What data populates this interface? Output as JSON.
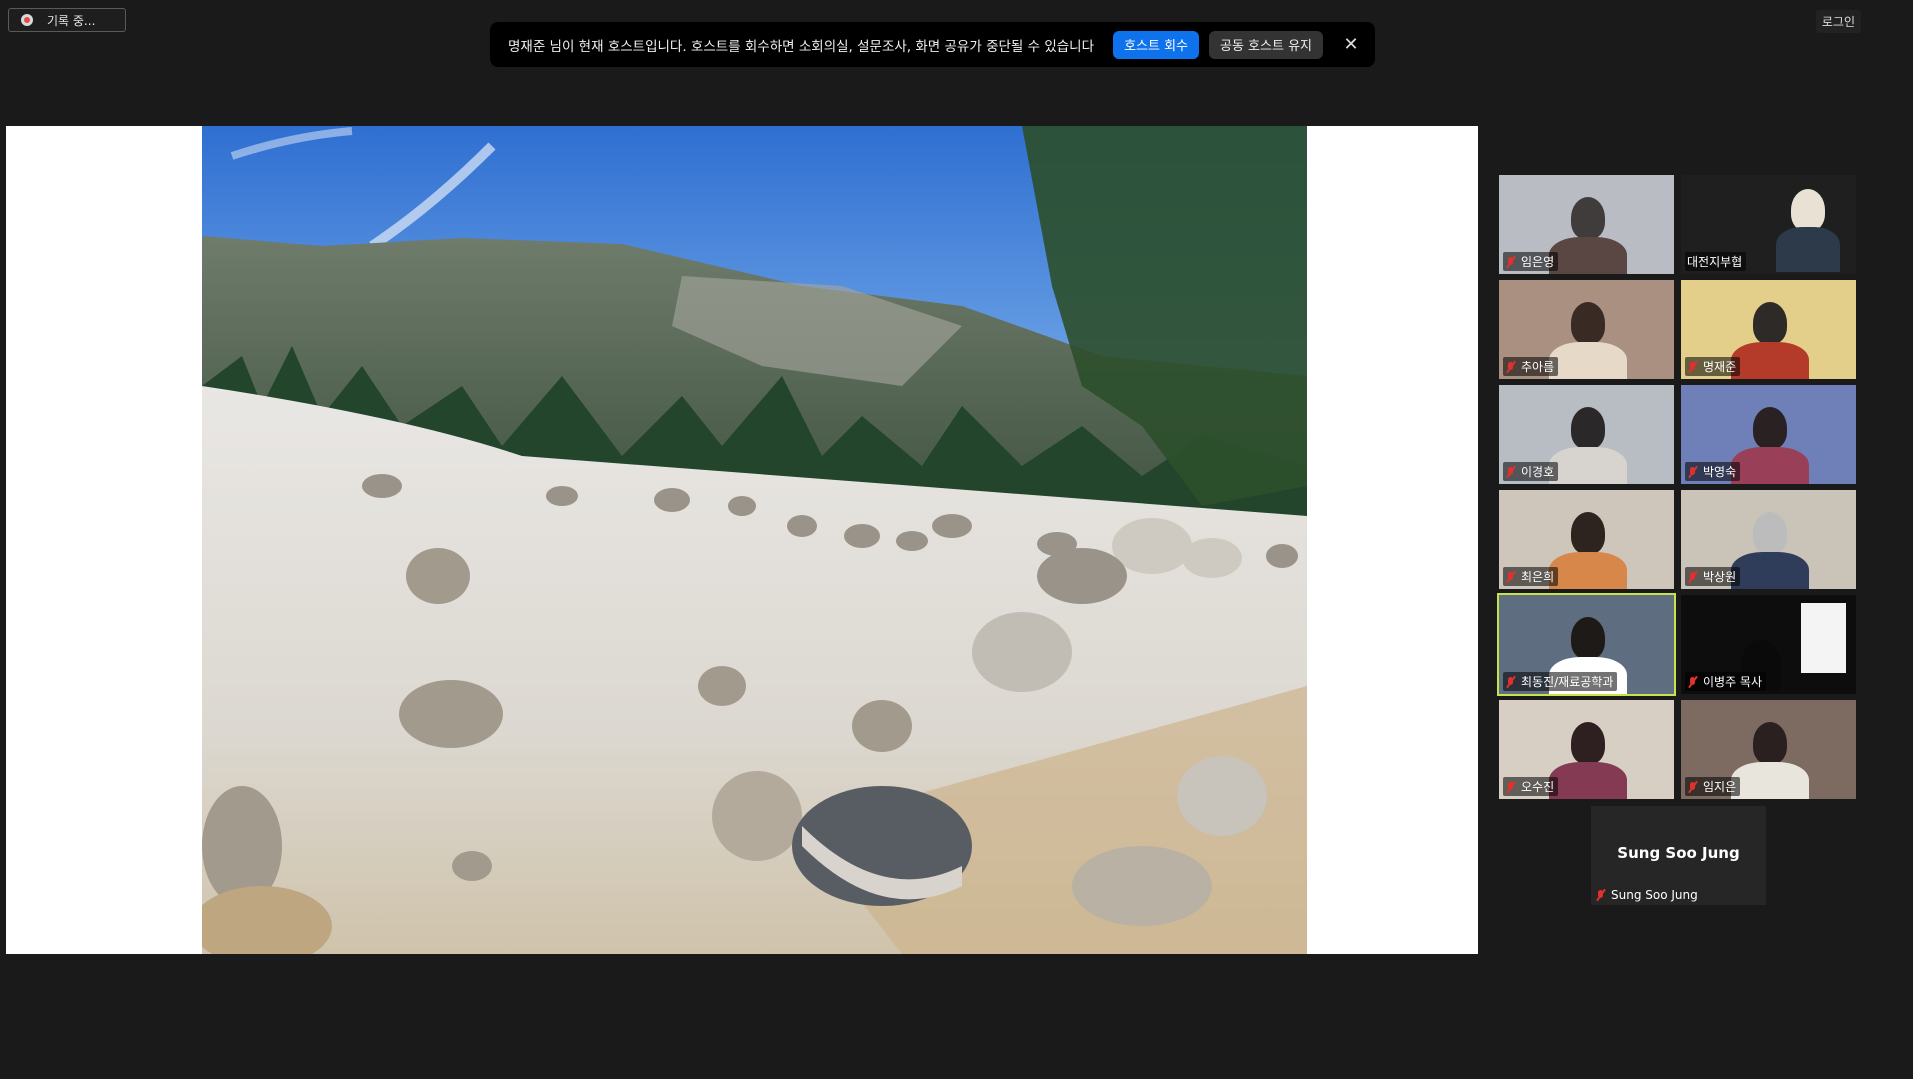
{
  "recording": {
    "label": "기록 중..."
  },
  "banner": {
    "message": "명재준 님이 현재 호스트입니다. 호스트를 회수하면 소회의실, 설문조사, 화면 공유가 중단될 수 있습니다",
    "reclaim_label": "호스트 회수",
    "keep_cohost_label": "공동 호스트 유지",
    "close_icon": "close-icon"
  },
  "login": {
    "label": "로그인"
  },
  "participants": [
    {
      "name": "임은영",
      "muted": true
    },
    {
      "name": "대전지부협",
      "muted": false
    },
    {
      "name": "추아름",
      "muted": true
    },
    {
      "name": "명재준",
      "muted": true
    },
    {
      "name": "이경호",
      "muted": true
    },
    {
      "name": "박영숙",
      "muted": true
    },
    {
      "name": "최은희",
      "muted": true
    },
    {
      "name": "박상원",
      "muted": true
    },
    {
      "name": "최동진/재료공학과",
      "muted": true,
      "active_speaker": true
    },
    {
      "name": "이병주 목사",
      "muted": true
    },
    {
      "name": "오수진",
      "muted": true
    },
    {
      "name": "임지은",
      "muted": true
    }
  ],
  "solo_participant": {
    "display": "Sung Soo Jung",
    "name": "Sung Soo Jung",
    "muted": true
  },
  "colors": {
    "accent": "#0e72ed",
    "active_border": "#c7e34a",
    "muted_icon": "#e0312f"
  }
}
